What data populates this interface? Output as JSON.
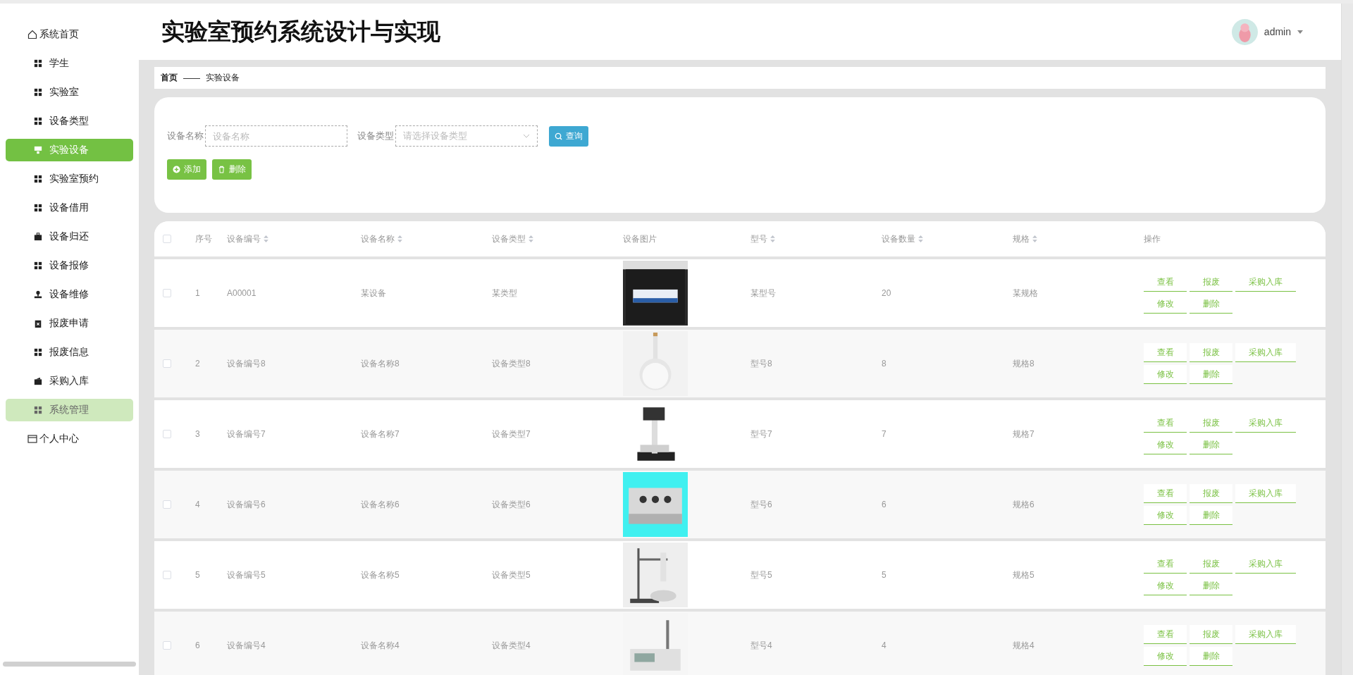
{
  "sidebar": {
    "items": [
      {
        "label": "系统首页",
        "kind": "home",
        "selected": false,
        "hovered": false
      },
      {
        "label": "学生",
        "kind": "grid",
        "selected": false,
        "hovered": false
      },
      {
        "label": "实验室",
        "kind": "grid",
        "selected": false,
        "hovered": false
      },
      {
        "label": "设备类型",
        "kind": "grid",
        "selected": false,
        "hovered": false
      },
      {
        "label": "实验设备",
        "kind": "monitor",
        "selected": true,
        "hovered": false
      },
      {
        "label": "实验室预约",
        "kind": "grid",
        "selected": false,
        "hovered": false
      },
      {
        "label": "设备借用",
        "kind": "grid",
        "selected": false,
        "hovered": false
      },
      {
        "label": "设备归还",
        "kind": "briefcase",
        "selected": false,
        "hovered": false
      },
      {
        "label": "设备报修",
        "kind": "grid",
        "selected": false,
        "hovered": false
      },
      {
        "label": "设备维修",
        "kind": "stamp",
        "selected": false,
        "hovered": false
      },
      {
        "label": "报废申请",
        "kind": "clipboard",
        "selected": false,
        "hovered": false
      },
      {
        "label": "报废信息",
        "kind": "grid",
        "selected": false,
        "hovered": false
      },
      {
        "label": "采购入库",
        "kind": "wallet",
        "selected": false,
        "hovered": false
      },
      {
        "label": "系统管理",
        "kind": "grid",
        "selected": false,
        "hovered": true
      },
      {
        "label": "个人中心",
        "kind": "card",
        "selected": false,
        "hovered": false
      }
    ]
  },
  "header": {
    "title": "实验室预约系统设计与实现",
    "user": "admin"
  },
  "breadcrumb": [
    "首页",
    "——",
    "实验设备"
  ],
  "search": {
    "fields": [
      {
        "kind": "text",
        "label": "设备名称",
        "placeholder": "设备名称"
      },
      {
        "kind": "select",
        "label": "设备类型",
        "placeholder": "请选择设备类型"
      }
    ],
    "query_button": "查询",
    "add_button": "添加",
    "delete_button": "删除"
  },
  "table": {
    "header_checked": false,
    "columns": [
      {
        "label": "序号",
        "sortable": false
      },
      {
        "label": "设备编号",
        "sortable": true
      },
      {
        "label": "设备名称",
        "sortable": true
      },
      {
        "label": "设备类型",
        "sortable": true
      },
      {
        "label": "设备图片",
        "sortable": false
      },
      {
        "label": "型号",
        "sortable": true
      },
      {
        "label": "设备数量",
        "sortable": true
      },
      {
        "label": "规格",
        "sortable": true
      },
      {
        "label": "操作",
        "sortable": false
      }
    ],
    "rows": [
      {
        "checked": false,
        "index": "1",
        "code": "A00001",
        "name": "某设备",
        "type": "某类型",
        "model": "某型号",
        "quantity": "20",
        "spec": "某规格",
        "actions": [
          "查看",
          "报废",
          "采购入库",
          "修改",
          "删除"
        ]
      },
      {
        "checked": false,
        "index": "2",
        "code": "设备编号8",
        "name": "设备名称8",
        "type": "设备类型8",
        "model": "型号8",
        "quantity": "8",
        "spec": "规格8",
        "actions": [
          "查看",
          "报废",
          "采购入库",
          "修改",
          "删除"
        ]
      },
      {
        "checked": false,
        "index": "3",
        "code": "设备编号7",
        "name": "设备名称7",
        "type": "设备类型7",
        "model": "型号7",
        "quantity": "7",
        "spec": "规格7",
        "actions": [
          "查看",
          "报废",
          "采购入库",
          "修改",
          "删除"
        ]
      },
      {
        "checked": false,
        "index": "4",
        "code": "设备编号6",
        "name": "设备名称6",
        "type": "设备类型6",
        "model": "型号6",
        "quantity": "6",
        "spec": "规格6",
        "actions": [
          "查看",
          "报废",
          "采购入库",
          "修改",
          "删除"
        ]
      },
      {
        "checked": false,
        "index": "5",
        "code": "设备编号5",
        "name": "设备名称5",
        "type": "设备类型5",
        "model": "型号5",
        "quantity": "5",
        "spec": "规格5",
        "actions": [
          "查看",
          "报废",
          "采购入库",
          "修改",
          "删除"
        ]
      },
      {
        "checked": false,
        "index": "6",
        "code": "设备编号4",
        "name": "设备名称4",
        "type": "设备类型4",
        "model": "型号4",
        "quantity": "4",
        "spec": "规格4",
        "actions": [
          "查看",
          "报废",
          "采购入库",
          "修改",
          "删除"
        ]
      }
    ]
  }
}
